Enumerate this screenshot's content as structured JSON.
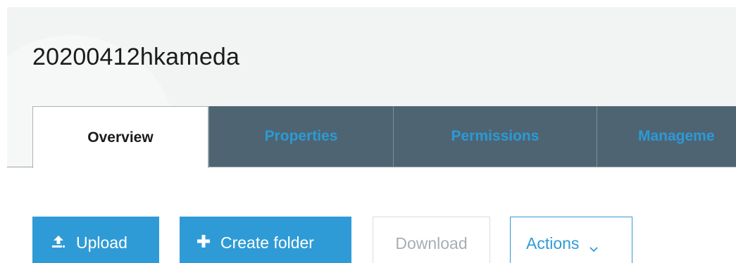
{
  "header": {
    "title": "20200412hkameda"
  },
  "tabs": [
    {
      "label": "Overview",
      "active": true
    },
    {
      "label": "Properties",
      "active": false
    },
    {
      "label": "Permissions",
      "active": false
    },
    {
      "label": "Manageme",
      "active": false
    }
  ],
  "toolbar": {
    "upload_label": "Upload",
    "upload_icon": "upload-icon",
    "create_folder_label": "Create folder",
    "create_folder_icon": "plus-icon",
    "download_label": "Download",
    "actions_label": "Actions",
    "actions_icon": "chevron-down-icon"
  },
  "colors": {
    "primary": "#2f9bd6",
    "tab_inactive_bg": "#4e6472",
    "header_bg": "#f2f3f3",
    "disabled_text": "#a7aeb2"
  }
}
